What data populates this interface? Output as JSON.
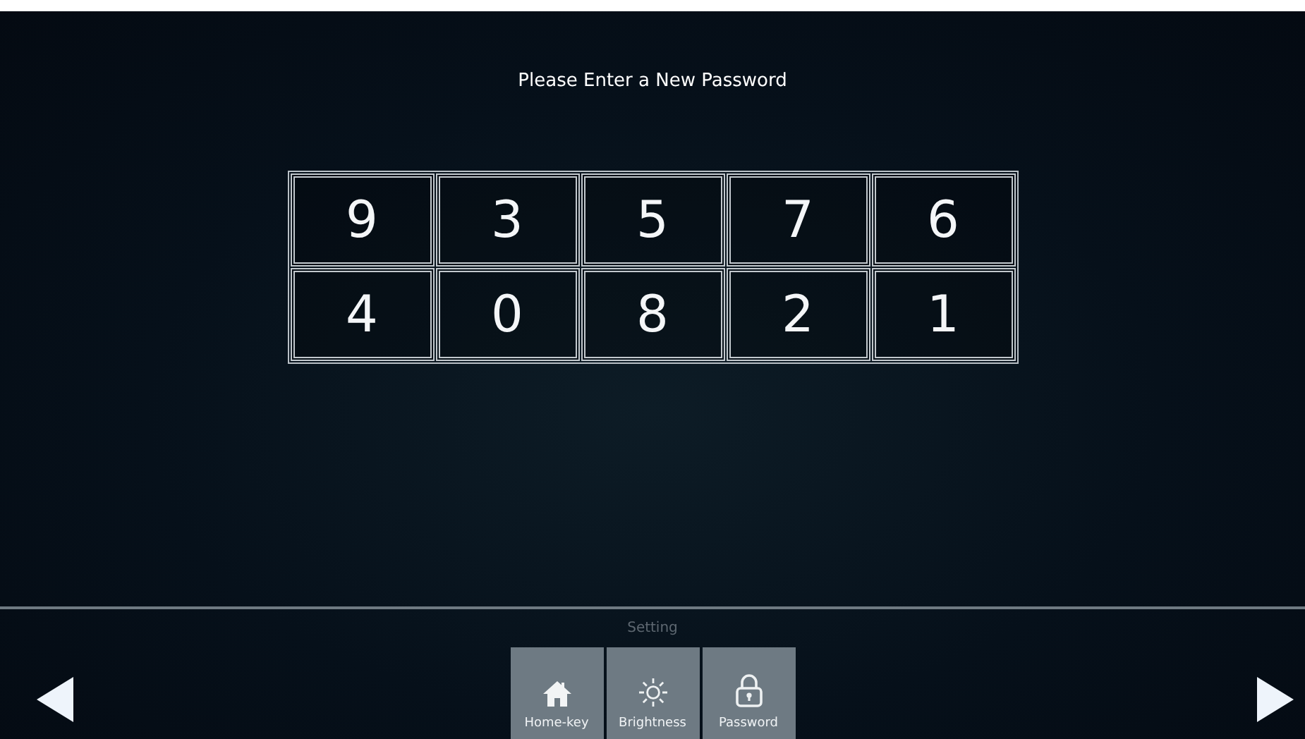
{
  "title": "Please Enter a New Password",
  "keypad": [
    [
      "9",
      "3",
      "5",
      "7",
      "6"
    ],
    [
      "4",
      "0",
      "8",
      "2",
      "1"
    ]
  ],
  "settings": {
    "label": "Setting",
    "buttons": [
      {
        "kind": "home",
        "label": "Home-key"
      },
      {
        "kind": "brightness",
        "label": "Brightness"
      },
      {
        "kind": "lock",
        "label": "Password"
      }
    ]
  }
}
